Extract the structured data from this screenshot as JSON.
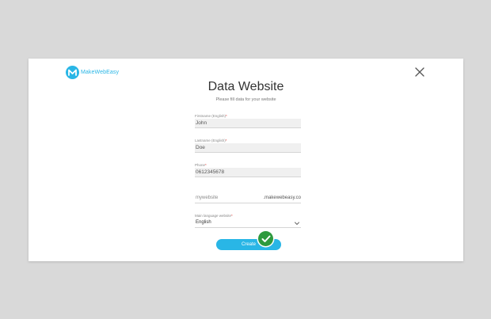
{
  "brand": {
    "name": "MakeWebEasy",
    "color": "#29b6e6"
  },
  "dialog": {
    "title": "Data Website",
    "subtitle": "Please fill data for your website",
    "close_icon": "close-icon"
  },
  "form": {
    "firstname": {
      "label": "Firstname (English)",
      "value": "John"
    },
    "lastname": {
      "label": "Lastname (English)",
      "value": "Doe"
    },
    "phone": {
      "label": "Phone",
      "value": "0612345678"
    },
    "domain": {
      "placeholder": "mywebsite",
      "suffix": ".makewebeasy.co"
    },
    "language": {
      "label": "Main language website",
      "selected": "English"
    },
    "required_mark": "*",
    "create_label": "Create"
  },
  "colors": {
    "accent": "#29b6e6",
    "success": "#2e9a3e",
    "required": "#e53935"
  },
  "icons": {
    "success": "check-icon",
    "select": "chevron-down-icon"
  }
}
